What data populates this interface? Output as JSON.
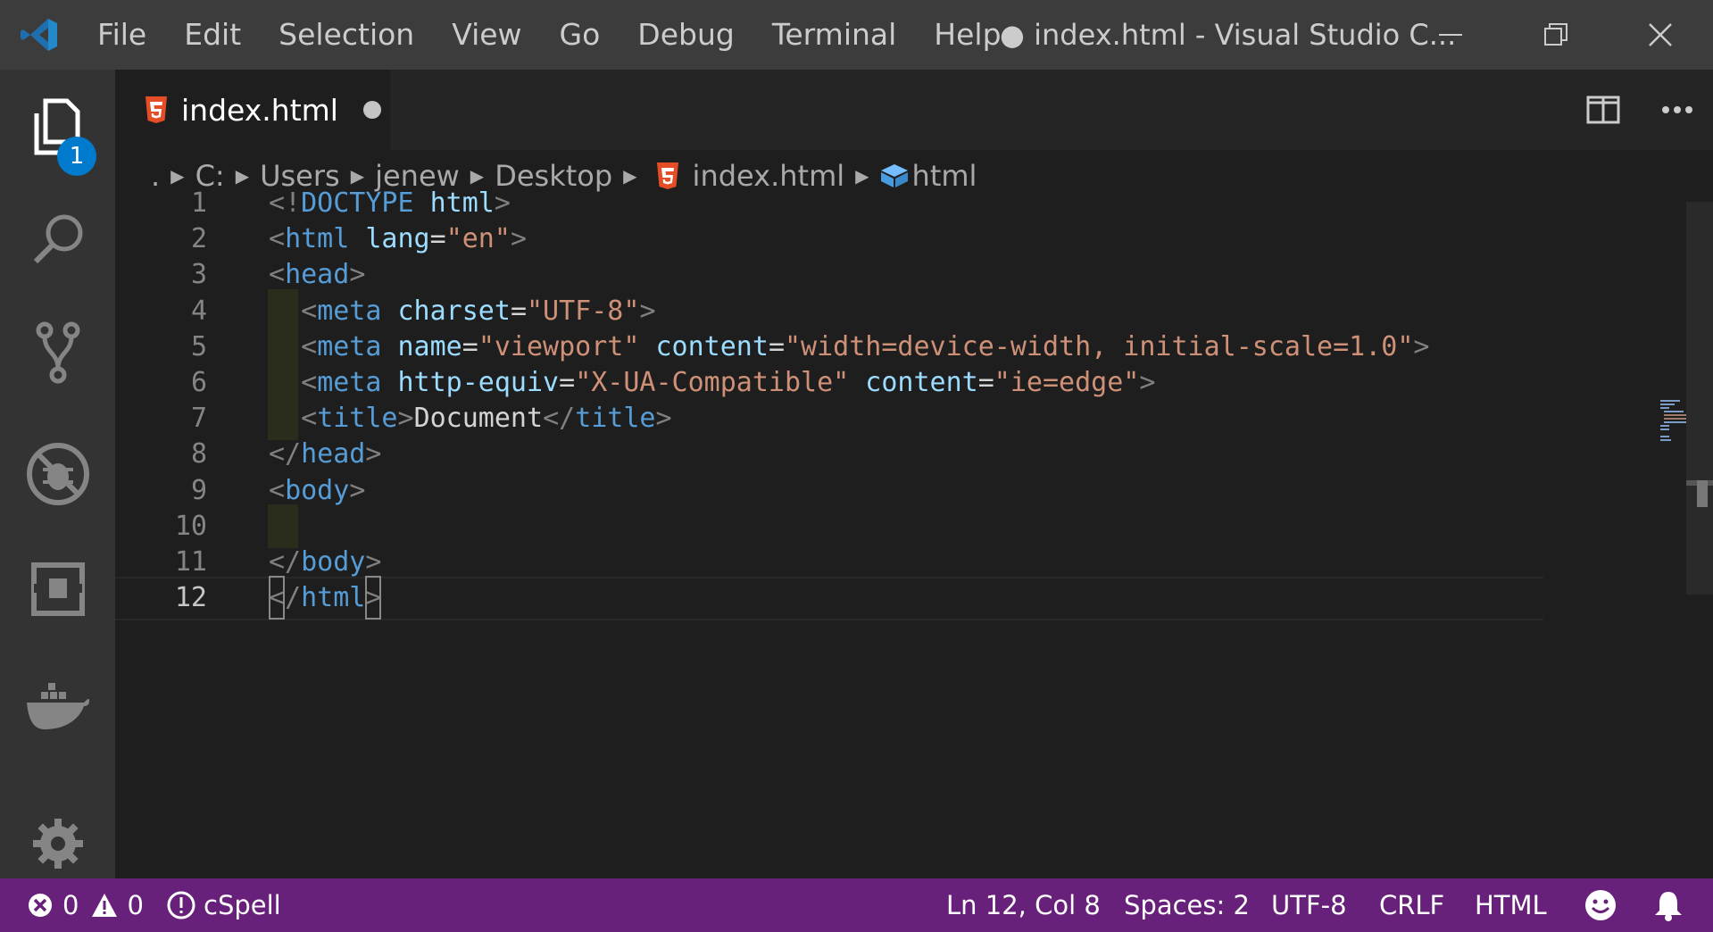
{
  "menu": [
    "File",
    "Edit",
    "Selection",
    "View",
    "Go",
    "Debug",
    "Terminal",
    "Help"
  ],
  "window_title": "● index.html - Visual Studio C...",
  "activity": {
    "explorer_badge": "1"
  },
  "tab": {
    "label": "index.html"
  },
  "breadcrumbs": {
    "root": ".",
    "items": [
      "C:",
      "Users",
      "jenew",
      "Desktop",
      "index.html",
      "html"
    ]
  },
  "editor": {
    "lines": [
      {
        "n": "1",
        "tokens": [
          [
            "p",
            "<!"
          ],
          [
            "t",
            "DOCTYPE"
          ],
          [
            "x",
            " "
          ],
          [
            "a",
            "html"
          ],
          [
            "p",
            ">"
          ]
        ]
      },
      {
        "n": "2",
        "tokens": [
          [
            "p",
            "<"
          ],
          [
            "t",
            "html"
          ],
          [
            "x",
            " "
          ],
          [
            "a",
            "lang"
          ],
          [
            "x",
            "="
          ],
          [
            "s",
            "\"en\""
          ],
          [
            "p",
            ">"
          ]
        ]
      },
      {
        "n": "3",
        "tokens": [
          [
            "p",
            "<"
          ],
          [
            "t",
            "head"
          ],
          [
            "p",
            ">"
          ]
        ]
      },
      {
        "n": "4",
        "indent": true,
        "tokens": [
          [
            "x",
            "  "
          ],
          [
            "p",
            "<"
          ],
          [
            "t",
            "meta"
          ],
          [
            "x",
            " "
          ],
          [
            "a",
            "charset"
          ],
          [
            "x",
            "="
          ],
          [
            "s",
            "\"UTF-8\""
          ],
          [
            "p",
            ">"
          ]
        ]
      },
      {
        "n": "5",
        "indent": true,
        "tokens": [
          [
            "x",
            "  "
          ],
          [
            "p",
            "<"
          ],
          [
            "t",
            "meta"
          ],
          [
            "x",
            " "
          ],
          [
            "a",
            "name"
          ],
          [
            "x",
            "="
          ],
          [
            "s",
            "\"viewport\""
          ],
          [
            "x",
            " "
          ],
          [
            "a",
            "content"
          ],
          [
            "x",
            "="
          ],
          [
            "s",
            "\"width=device-width, initial-scale=1.0\""
          ],
          [
            "p",
            ">"
          ]
        ]
      },
      {
        "n": "6",
        "indent": true,
        "tokens": [
          [
            "x",
            "  "
          ],
          [
            "p",
            "<"
          ],
          [
            "t",
            "meta"
          ],
          [
            "x",
            " "
          ],
          [
            "a",
            "http-equiv"
          ],
          [
            "x",
            "="
          ],
          [
            "s",
            "\"X-UA-Compatible\""
          ],
          [
            "x",
            " "
          ],
          [
            "a",
            "content"
          ],
          [
            "x",
            "="
          ],
          [
            "s",
            "\"ie=edge\""
          ],
          [
            "p",
            ">"
          ]
        ]
      },
      {
        "n": "7",
        "indent": true,
        "tokens": [
          [
            "x",
            "  "
          ],
          [
            "p",
            "<"
          ],
          [
            "t",
            "title"
          ],
          [
            "p",
            ">"
          ],
          [
            "x",
            "Document"
          ],
          [
            "p",
            "</"
          ],
          [
            "t",
            "title"
          ],
          [
            "p",
            ">"
          ]
        ]
      },
      {
        "n": "8",
        "tokens": [
          [
            "p",
            "</"
          ],
          [
            "t",
            "head"
          ],
          [
            "p",
            ">"
          ]
        ]
      },
      {
        "n": "9",
        "tokens": [
          [
            "p",
            "<"
          ],
          [
            "t",
            "body"
          ],
          [
            "p",
            ">"
          ]
        ]
      },
      {
        "n": "10",
        "indent": true,
        "tokens": []
      },
      {
        "n": "11",
        "tokens": [
          [
            "p",
            "</"
          ],
          [
            "t",
            "body"
          ],
          [
            "p",
            ">"
          ]
        ]
      },
      {
        "n": "12",
        "active": true,
        "tokens": [
          [
            "bp",
            "<"
          ],
          [
            "p",
            "/"
          ],
          [
            "t",
            "html"
          ],
          [
            "bp",
            ">"
          ]
        ]
      }
    ]
  },
  "status": {
    "errors": "0",
    "warnings": "0",
    "cspell": "cSpell",
    "position": "Ln 12, Col 8",
    "spaces": "Spaces: 2",
    "encoding": "UTF-8",
    "eol": "CRLF",
    "language": "HTML"
  },
  "colors": {
    "statusbar": "#68217a",
    "accent": "#007acc",
    "html5": "#e44d26"
  }
}
